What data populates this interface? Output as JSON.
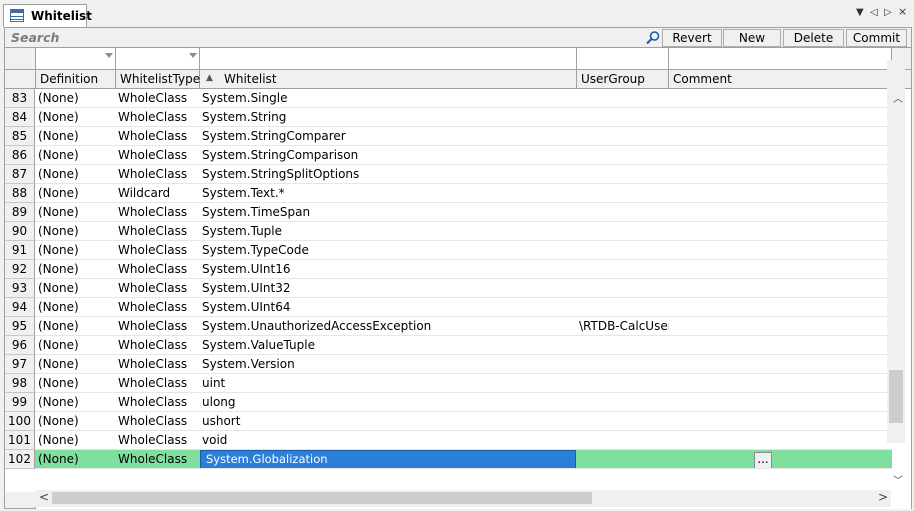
{
  "tab": {
    "title": "Whitelist"
  },
  "toolbar": {
    "search_label": "Search",
    "buttons": [
      "Revert",
      "New",
      "Delete",
      "Commit"
    ]
  },
  "grid": {
    "columns": [
      "Definition",
      "WhitelistType",
      "Whitelist",
      "UserGroup",
      "Comment"
    ],
    "sorted_column": "Whitelist",
    "sort_direction": "ascending",
    "rows": [
      {
        "num": "83",
        "definition": "(None)",
        "type": "WholeClass",
        "whitelist": "System.Single",
        "usergroup": "",
        "comment": ""
      },
      {
        "num": "84",
        "definition": "(None)",
        "type": "WholeClass",
        "whitelist": "System.String",
        "usergroup": "",
        "comment": ""
      },
      {
        "num": "85",
        "definition": "(None)",
        "type": "WholeClass",
        "whitelist": "System.StringComparer",
        "usergroup": "",
        "comment": ""
      },
      {
        "num": "86",
        "definition": "(None)",
        "type": "WholeClass",
        "whitelist": "System.StringComparison",
        "usergroup": "",
        "comment": ""
      },
      {
        "num": "87",
        "definition": "(None)",
        "type": "WholeClass",
        "whitelist": "System.StringSplitOptions",
        "usergroup": "",
        "comment": ""
      },
      {
        "num": "88",
        "definition": "(None)",
        "type": "Wildcard",
        "whitelist": "System.Text.*",
        "usergroup": "",
        "comment": ""
      },
      {
        "num": "89",
        "definition": "(None)",
        "type": "WholeClass",
        "whitelist": "System.TimeSpan",
        "usergroup": "",
        "comment": ""
      },
      {
        "num": "90",
        "definition": "(None)",
        "type": "WholeClass",
        "whitelist": "System.Tuple",
        "usergroup": "",
        "comment": ""
      },
      {
        "num": "91",
        "definition": "(None)",
        "type": "WholeClass",
        "whitelist": "System.TypeCode",
        "usergroup": "",
        "comment": ""
      },
      {
        "num": "92",
        "definition": "(None)",
        "type": "WholeClass",
        "whitelist": "System.UInt16",
        "usergroup": "",
        "comment": ""
      },
      {
        "num": "93",
        "definition": "(None)",
        "type": "WholeClass",
        "whitelist": "System.UInt32",
        "usergroup": "",
        "comment": ""
      },
      {
        "num": "94",
        "definition": "(None)",
        "type": "WholeClass",
        "whitelist": "System.UInt64",
        "usergroup": "",
        "comment": ""
      },
      {
        "num": "95",
        "definition": "(None)",
        "type": "WholeClass",
        "whitelist": "System.UnauthorizedAccessException",
        "usergroup": "\\RTDB-CalcUser",
        "comment": ""
      },
      {
        "num": "96",
        "definition": "(None)",
        "type": "WholeClass",
        "whitelist": "System.ValueTuple",
        "usergroup": "",
        "comment": ""
      },
      {
        "num": "97",
        "definition": "(None)",
        "type": "WholeClass",
        "whitelist": "System.Version",
        "usergroup": "",
        "comment": ""
      },
      {
        "num": "98",
        "definition": "(None)",
        "type": "WholeClass",
        "whitelist": "uint",
        "usergroup": "",
        "comment": ""
      },
      {
        "num": "99",
        "definition": "(None)",
        "type": "WholeClass",
        "whitelist": "ulong",
        "usergroup": "",
        "comment": ""
      },
      {
        "num": "100",
        "definition": "(None)",
        "type": "WholeClass",
        "whitelist": "ushort",
        "usergroup": "",
        "comment": ""
      },
      {
        "num": "101",
        "definition": "(None)",
        "type": "WholeClass",
        "whitelist": "void",
        "usergroup": "",
        "comment": ""
      },
      {
        "num": "102",
        "definition": "(None)",
        "type": "WholeClass",
        "whitelist": "System.Globalization",
        "usergroup": "",
        "comment": "",
        "selected": true,
        "editing": true
      }
    ],
    "edit_button_label": "..."
  },
  "colors": {
    "selected_row": "#7fdf9f",
    "editing_cell": "#2b7fd9",
    "header_bg": "#f0f0f0"
  },
  "icons": [
    "table-icon",
    "search-icon",
    "menu-dropdown-icon",
    "scroll-left-icon",
    "scroll-right-icon",
    "scroll-up-icon",
    "scroll-down-icon",
    "sort-ascending-icon",
    "filter-dropdown-icon"
  ]
}
